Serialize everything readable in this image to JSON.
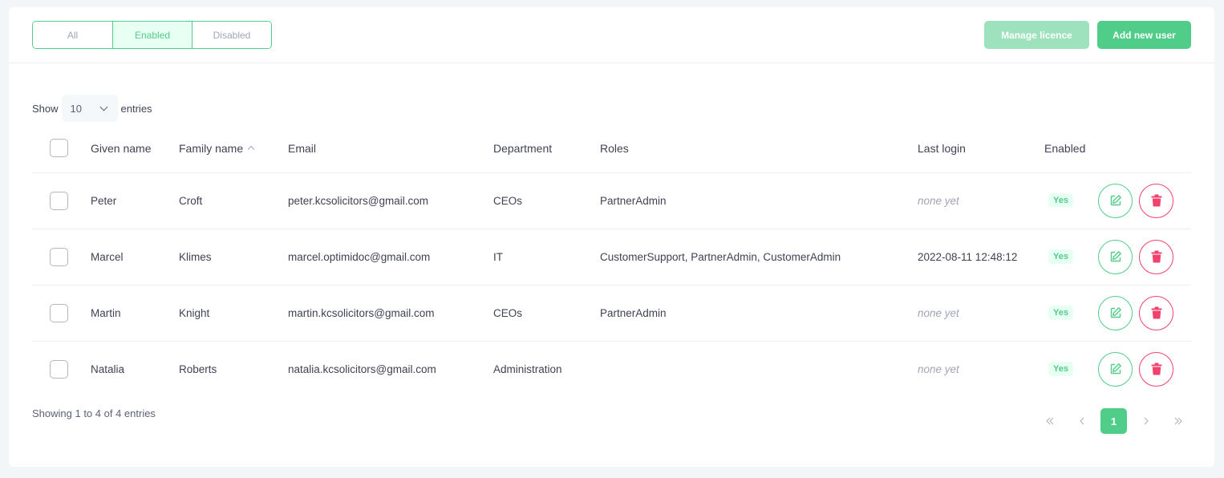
{
  "filters": {
    "items": [
      {
        "label": "All",
        "active": false
      },
      {
        "label": "Enabled",
        "active": true
      },
      {
        "label": "Disabled",
        "active": false
      }
    ]
  },
  "actions": {
    "manage_label": "Manage licence",
    "add_label": "Add new user"
  },
  "length": {
    "show_label": "Show",
    "value": "10",
    "entries_label": "entries"
  },
  "table": {
    "columns": [
      "Given name",
      "Family name",
      "Email",
      "Department",
      "Roles",
      "Last login",
      "Enabled"
    ],
    "rows": [
      {
        "given": "Peter",
        "family": "Croft",
        "email": "peter.kcsolicitors@gmail.com",
        "department": "CEOs",
        "roles": "PartnerAdmin",
        "last_login": "none yet",
        "enabled": "Yes"
      },
      {
        "given": "Marcel",
        "family": "Klimes",
        "email": "marcel.optimidoc@gmail.com",
        "department": "IT",
        "roles": "CustomerSupport, PartnerAdmin, CustomerAdmin",
        "last_login": "2022-08-11 12:48:12",
        "enabled": "Yes"
      },
      {
        "given": "Martin",
        "family": "Knight",
        "email": "martin.kcsolicitors@gmail.com",
        "department": "CEOs",
        "roles": "PartnerAdmin",
        "last_login": "none yet",
        "enabled": "Yes"
      },
      {
        "given": "Natalia",
        "family": "Roberts",
        "email": "natalia.kcsolicitors@gmail.com",
        "department": "Administration",
        "roles": "",
        "last_login": "none yet",
        "enabled": "Yes"
      }
    ]
  },
  "footer": {
    "info": "Showing 1 to 4 of 4 entries",
    "current_page": "1"
  },
  "colors": {
    "accent": "#50cd89",
    "danger": "#f1416c",
    "muted": "#a1a5b7"
  }
}
